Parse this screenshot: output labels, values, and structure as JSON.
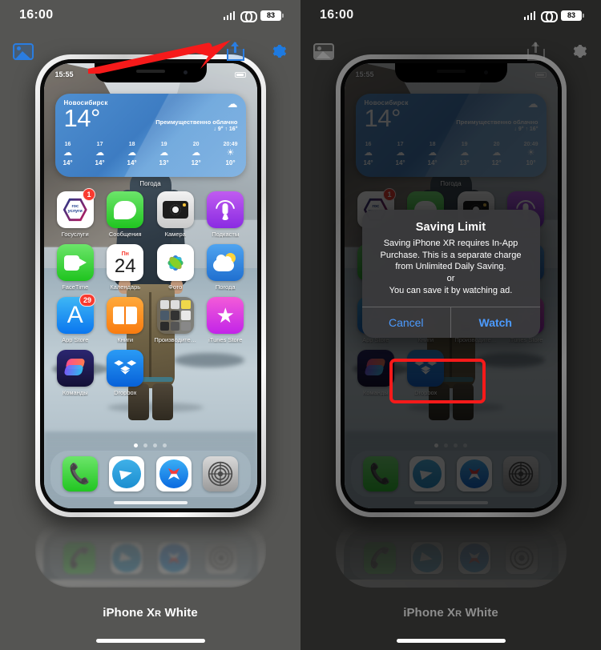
{
  "device_status": {
    "time": "16:00",
    "battery": "83",
    "signal_icon": "signal-bars-icon",
    "vpn_icon": "vpn-link-icon",
    "battery_icon": "battery-icon"
  },
  "toolbar": {
    "photo_icon": "photo-library-icon",
    "save_icon": "save-upload-icon",
    "gear_icon": "settings-gear-icon"
  },
  "annotations": {
    "arrow_icon": "red-arrow-pointing-to-save-icon",
    "highlight_box": "red-highlight-box-around-watch-button"
  },
  "phone_preview": {
    "status_time": "15:55",
    "battery_icon": "battery-icon",
    "caption": "iPhone X",
    "caption_sub": "R",
    "caption_end": " White",
    "caption_full": "iPhone Xʀ White",
    "page_dots": {
      "count": 4,
      "active": 1
    }
  },
  "weather_widget": {
    "city": "Новосибирск",
    "temperature": "14°",
    "condition": "Преимущественно облачно",
    "range": "↓ 9° ↑ 16°",
    "main_icon": "cloud-icon",
    "label": "Погода",
    "hours": [
      {
        "time": "16",
        "icon": "☁",
        "temp": "14°"
      },
      {
        "time": "17",
        "icon": "☁",
        "temp": "14°"
      },
      {
        "time": "18",
        "icon": "☁",
        "temp": "14°"
      },
      {
        "time": "19",
        "icon": "☁",
        "temp": "13°"
      },
      {
        "time": "20",
        "icon": "☁",
        "temp": "12°"
      },
      {
        "time": "20:49",
        "icon": "☀",
        "temp": "10°"
      }
    ]
  },
  "home_screen": {
    "apps": [
      {
        "label": "Госуслуги",
        "icon": "gosuslugi-icon",
        "badge": "1"
      },
      {
        "label": "Сообщения",
        "icon": "messages-icon",
        "badge": null
      },
      {
        "label": "Камера",
        "icon": "camera-icon",
        "badge": null
      },
      {
        "label": "Подкасты",
        "icon": "podcasts-icon",
        "badge": null
      },
      {
        "label": "FaceTime",
        "icon": "facetime-icon",
        "badge": null
      },
      {
        "label": "Календарь",
        "icon": "calendar-icon",
        "badge": null,
        "cal_day": "Пн",
        "cal_num": "24"
      },
      {
        "label": "Фото",
        "icon": "photos-icon",
        "badge": null
      },
      {
        "label": "Погода",
        "icon": "weather-icon",
        "badge": null
      },
      {
        "label": "App Store",
        "icon": "app-store-icon",
        "badge": "29"
      },
      {
        "label": "Книги",
        "icon": "books-icon",
        "badge": null
      },
      {
        "label": "Производите…",
        "icon": "folder-icon",
        "badge": null
      },
      {
        "label": "iTunes Store",
        "icon": "itunes-store-icon",
        "badge": null
      },
      {
        "label": "Команды",
        "icon": "shortcuts-icon",
        "badge": null
      },
      {
        "label": "Dropbox",
        "icon": "dropbox-icon",
        "badge": null
      }
    ],
    "dock": [
      {
        "label": "Телефон",
        "icon": "phone-icon"
      },
      {
        "label": "Telegram",
        "icon": "telegram-icon"
      },
      {
        "label": "Safari",
        "icon": "safari-icon"
      },
      {
        "label": "Настройки",
        "icon": "settings-icon"
      }
    ]
  },
  "dialog": {
    "title": "Saving Limit",
    "message_lines": [
      "Saving iPhone XR requires In-App",
      "Purchase. This is a separate charge",
      "from Unlimited Daily Saving.",
      "or",
      "You can save it by watching ad."
    ],
    "cancel_label": "Cancel",
    "watch_label": "Watch"
  },
  "colors": {
    "accent_blue": "#2a7de1",
    "dialog_button_blue": "#4c9bff",
    "highlight_red": "#f61a1a",
    "badge_red": "#f93a2f",
    "panel_left_bg": "#555553",
    "panel_right_bg": "#262625"
  }
}
